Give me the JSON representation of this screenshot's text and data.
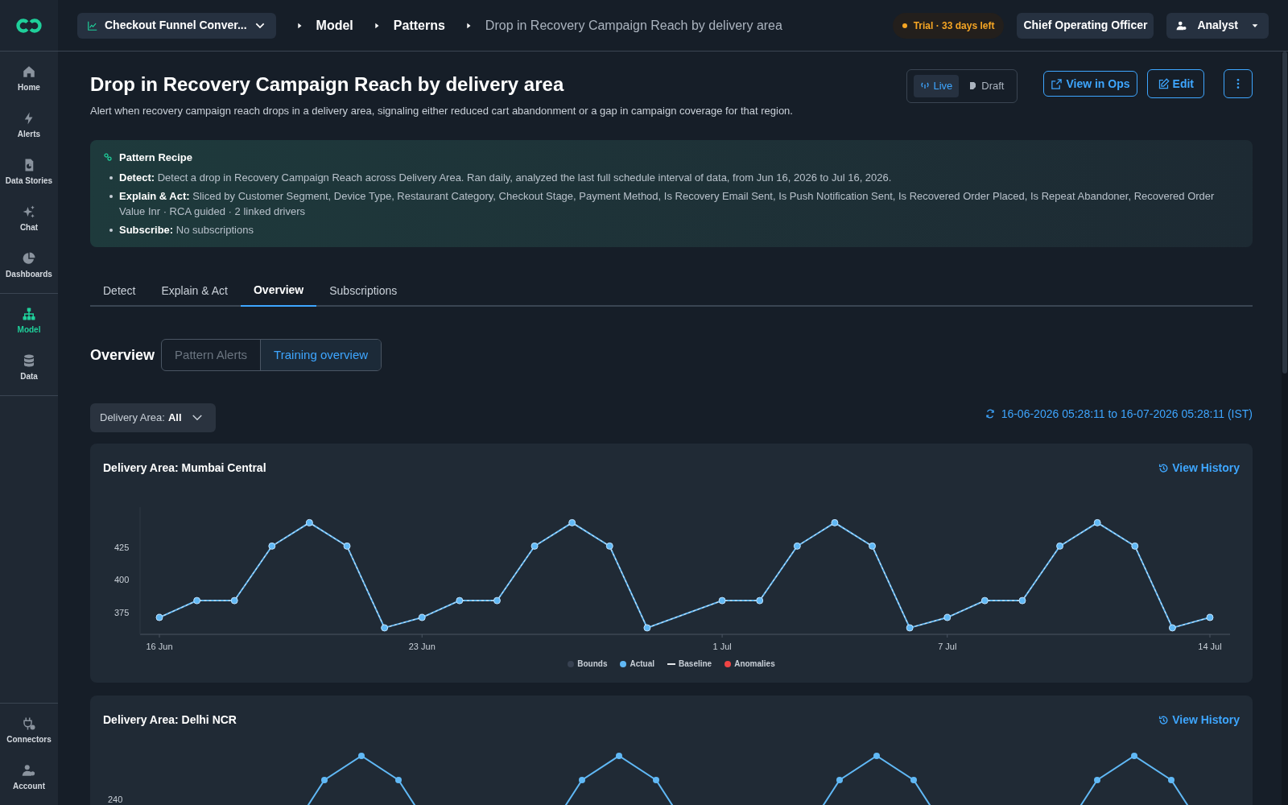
{
  "topbar": {
    "dataset": "Checkout Funnel Conver...",
    "breadcrumbs": [
      "Model",
      "Patterns",
      "Drop in Recovery Campaign Reach by delivery area"
    ],
    "trial": "Trial · 33 days left",
    "role": "Chief Operating Officer",
    "user": "Analyst"
  },
  "sidebar": {
    "items": [
      {
        "label": "Home",
        "selected": false
      },
      {
        "label": "Alerts",
        "selected": false
      },
      {
        "label": "Data Stories",
        "selected": false
      },
      {
        "label": "Chat",
        "selected": false
      },
      {
        "label": "Dashboards",
        "selected": false
      },
      {
        "label": "Model",
        "selected": true
      },
      {
        "label": "Data",
        "selected": false
      },
      {
        "label": "Connectors",
        "selected": false
      },
      {
        "label": "Account",
        "selected": false
      }
    ]
  },
  "header": {
    "title": "Drop in Recovery Campaign Reach by delivery area",
    "description": "Alert when recovery campaign reach drops in a delivery area, signaling either reduced cart abandonment or a gap in campaign coverage for that region.",
    "modes": [
      {
        "label": "Live",
        "selected": true
      },
      {
        "label": "Draft",
        "selected": false
      }
    ],
    "buttons": [
      {
        "label": "View in Ops",
        "kind": "link"
      },
      {
        "label": "Edit",
        "kind": "edit"
      },
      {
        "kind": "more"
      }
    ]
  },
  "recipe": {
    "title": "Pattern Recipe",
    "items": [
      {
        "label": "Detect:",
        "text": "Detect a drop in Recovery Campaign Reach across Delivery Area. Ran daily, analyzed the last full schedule interval of data, from Jun 16, 2026 to Jul 16, 2026."
      },
      {
        "label": "Explain & Act:",
        "text": "Sliced by Customer Segment, Device Type, Restaurant Category, Checkout Stage, Payment Method, Is Recovery Email Sent, Is Push Notification Sent, Is Recovered Order Placed, Is Repeat Abandoner, Recovered Order Value Inr · RCA guided · 2 linked drivers"
      },
      {
        "label": "Subscribe:",
        "text": "No subscriptions"
      }
    ]
  },
  "tabs": [
    {
      "label": "Detect",
      "selected": false
    },
    {
      "label": "Explain & Act",
      "selected": false
    },
    {
      "label": "Overview",
      "selected": true
    },
    {
      "label": "Subscriptions",
      "selected": false
    }
  ],
  "overview": {
    "title": "Overview",
    "segments": [
      {
        "label": "Pattern Alerts",
        "selected": false
      },
      {
        "label": "Training overview",
        "selected": true
      }
    ],
    "filter": {
      "label": "Delivery Area:",
      "value": "All"
    },
    "range": "16-06-2026 05:28:11 to 16-07-2026 05:28:11 (IST)"
  },
  "charts": [
    {
      "title": "Delivery Area: Mumbai Central",
      "action": "View History",
      "chart_data": {
        "type": "line",
        "categories": [
          "16 Jun",
          null,
          null,
          null,
          null,
          null,
          null,
          "23 Jun",
          null,
          null,
          null,
          null,
          null,
          null,
          null,
          "1 Jul",
          null,
          null,
          null,
          null,
          null,
          "7 Jul",
          null,
          null,
          null,
          null,
          null,
          null,
          "14 Jul"
        ],
        "ylim": [
          358,
          456
        ],
        "yticks": [
          375,
          400,
          425
        ],
        "series": [
          {
            "name": "Actual",
            "color": "#60b8f5",
            "marker": "circle",
            "values": [
              371,
              384,
              384,
              426,
              444,
              426,
              363,
              371,
              384,
              384,
              426,
              444,
              426,
              363,
              null,
              384,
              384,
              426,
              444,
              426,
              363,
              371,
              384,
              384,
              426,
              444,
              426,
              363,
              371
            ]
          },
          {
            "name": "Baseline",
            "color": "#e5e7eb",
            "line_style": "dashed",
            "values": [
              371,
              384,
              384,
              426,
              444,
              426,
              363,
              371,
              384,
              384,
              426,
              444,
              426,
              363,
              null,
              384,
              384,
              426,
              444,
              426,
              363,
              371,
              384,
              384,
              426,
              444,
              426,
              363,
              371
            ]
          }
        ]
      },
      "legend": [
        {
          "label": "Bounds",
          "color": "#374151"
        },
        {
          "label": "Anomalies",
          "color": "#ef4444"
        }
      ]
    },
    {
      "title": "Delivery Area: Delhi NCR",
      "action": "View History",
      "kind": "picture",
      "ytick": "240"
    }
  ]
}
